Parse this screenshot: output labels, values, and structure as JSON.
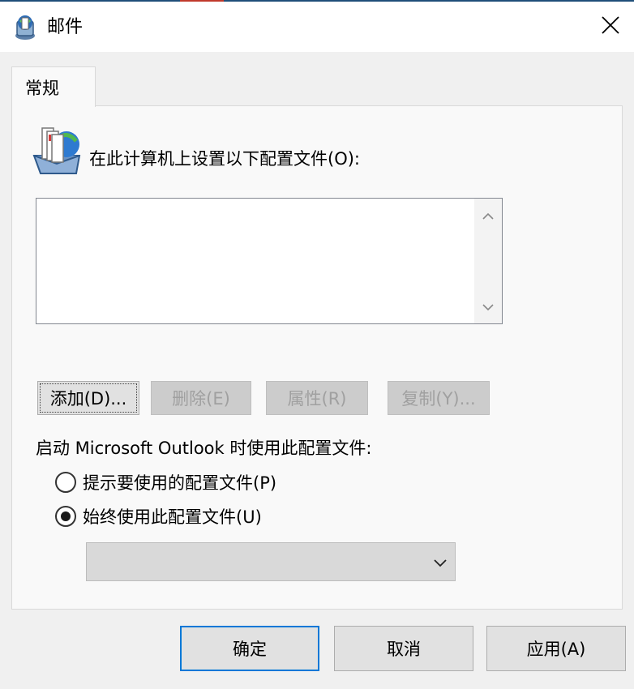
{
  "window": {
    "title": "邮件",
    "app_icon": "mail-globe-icon",
    "close_icon": "close-icon"
  },
  "tabs": [
    {
      "label": "常规",
      "selected": true
    }
  ],
  "general": {
    "profiles_icon": "mail-profiles-icon",
    "profiles_label": "在此计算机上设置以下配置文件(O):",
    "profiles_list": [],
    "buttons": {
      "add": "添加(D)...",
      "delete": "删除(E)",
      "properties": "属性(R)",
      "copy": "复制(Y)..."
    },
    "startup_label": "启动 Microsoft Outlook 时使用此配置文件:",
    "options": [
      {
        "label": "提示要使用的配置文件(P)",
        "selected": false
      },
      {
        "label": "始终使用此配置文件(U)",
        "selected": true
      }
    ],
    "profile_select_value": ""
  },
  "dialog_buttons": {
    "ok": "确定",
    "cancel": "取消",
    "apply": "应用(A)"
  },
  "colors": {
    "focus_border": "#0078d7",
    "disabled_text": "#a0a0a0"
  }
}
